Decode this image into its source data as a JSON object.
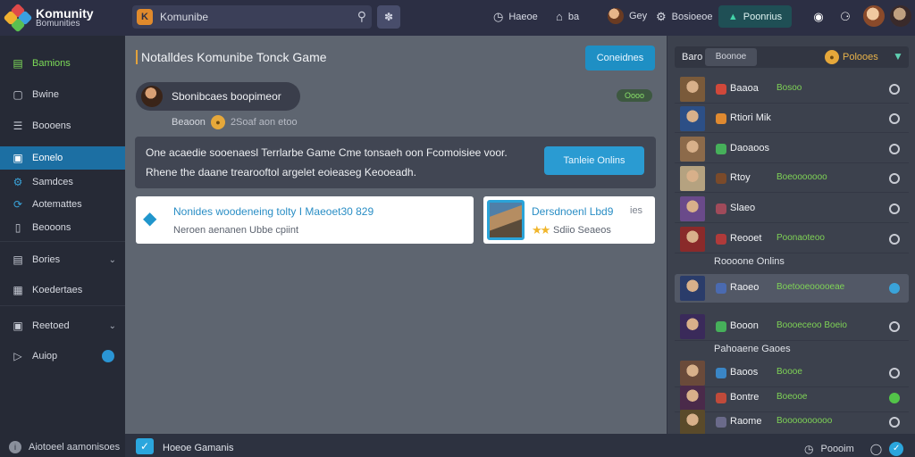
{
  "app": {
    "logo_line1": "Komunity",
    "logo_line2": "Bomunities"
  },
  "topbar": {
    "search_placeholder": "Komunibe",
    "items": [
      {
        "label": "Haeoe"
      },
      {
        "label": "ba"
      },
      {
        "label": "Gey"
      },
      {
        "label": "Bosioeoe"
      }
    ],
    "premium_label": "Poonrius"
  },
  "sidebar": {
    "items": [
      {
        "label": "Bamions"
      },
      {
        "label": "Bwine"
      },
      {
        "label": "Boooens"
      },
      {
        "label": "Eonelo"
      },
      {
        "label": "Samdces"
      },
      {
        "label": "Aotemattes"
      },
      {
        "label": "Beooons"
      },
      {
        "label": "Bories"
      },
      {
        "label": "Koedertaes"
      },
      {
        "label": "Reetoed"
      },
      {
        "label": "Auiop"
      }
    ],
    "footer_label": "Aiotoeel aamonisoes"
  },
  "main": {
    "title": "Notalldes Komunibe Tonck Game",
    "primary_button": "Coneidnes",
    "user_name": "Sbonibcaes boopimeor",
    "status": "Oooo",
    "sub_label": "Beaoon",
    "sub_meta": "2Soaf aon etoo",
    "banner_line1": "One acaedie sooenaesl Terrlarbe Game Cme tonsaeh oon Fcomoisiee voor.",
    "banner_line2": "Rhene the daane trearooftol argelet eoieaseg Keooeadh.",
    "banner_button": "Tanleie Onlins",
    "card1_title": "Nonides woodeneing tolty I Maeoet30 829",
    "card1_sub": "Neroen aenanen Ubbe cpiint",
    "card2_title": "Dersdnoenl Lbd9",
    "card2_meta": "ies",
    "card2_sub": "Sdiio Seaeos"
  },
  "right_panel": {
    "header_label": "Baro",
    "header_tab": "Boonoe",
    "header_right": "Polooes",
    "friends_a": [
      {
        "name": "Baaoa",
        "game": "Bosoo",
        "av": "#7a5a3a",
        "dot": "#d0483a",
        "state": "off"
      },
      {
        "name": "Rtiori Mik",
        "game": "",
        "av": "#2c4f86",
        "dot": "#e08a30",
        "state": "off"
      },
      {
        "name": "Daoaoos",
        "game": "",
        "av": "#8c6a4a",
        "dot": "#46b05a",
        "state": "off"
      },
      {
        "name": "Rtoy",
        "game": "Boeooooooo",
        "av": "#b5a280",
        "dot": "#7a4a2a",
        "state": "off"
      },
      {
        "name": "Slaeo",
        "game": "",
        "av": "#6a4a8a",
        "dot": "#a04a5a",
        "state": "off"
      },
      {
        "name": "Reooet",
        "game": "Poonaoteoo",
        "av": "#8a2a2a",
        "dot": "#b03a3a",
        "state": "off"
      }
    ],
    "section1": "Roooone Onlins",
    "friend_highlight": {
      "name": "Raoeo",
      "game": "Boetooeooooeae",
      "av": "#2a3c6a",
      "dot": "#4a6ab0",
      "state": "on"
    },
    "friend_b": {
      "name": "Booon",
      "game": "Boooeceoo Boeio",
      "av": "#3a2a5a",
      "dot": "#46b05a",
      "state": "off"
    },
    "section2": "Pahoaene Gaoes",
    "friends_c": [
      {
        "name": "Baoos",
        "game": "Boooe",
        "av": "#6a4a3a",
        "dot": "#3a86c6",
        "state": "off"
      },
      {
        "name": "Bontre",
        "game": "Boeooe",
        "av": "#4a2a4a",
        "dot": "#c04a3a",
        "state": "grn"
      },
      {
        "name": "Raome",
        "game": "Boooooooooo",
        "av": "#5a4a2a",
        "dot": "#6a6a8a",
        "state": "off"
      }
    ]
  },
  "bottombar": {
    "label": "Hoeoe Gamanis",
    "right_label": "Poooim"
  }
}
